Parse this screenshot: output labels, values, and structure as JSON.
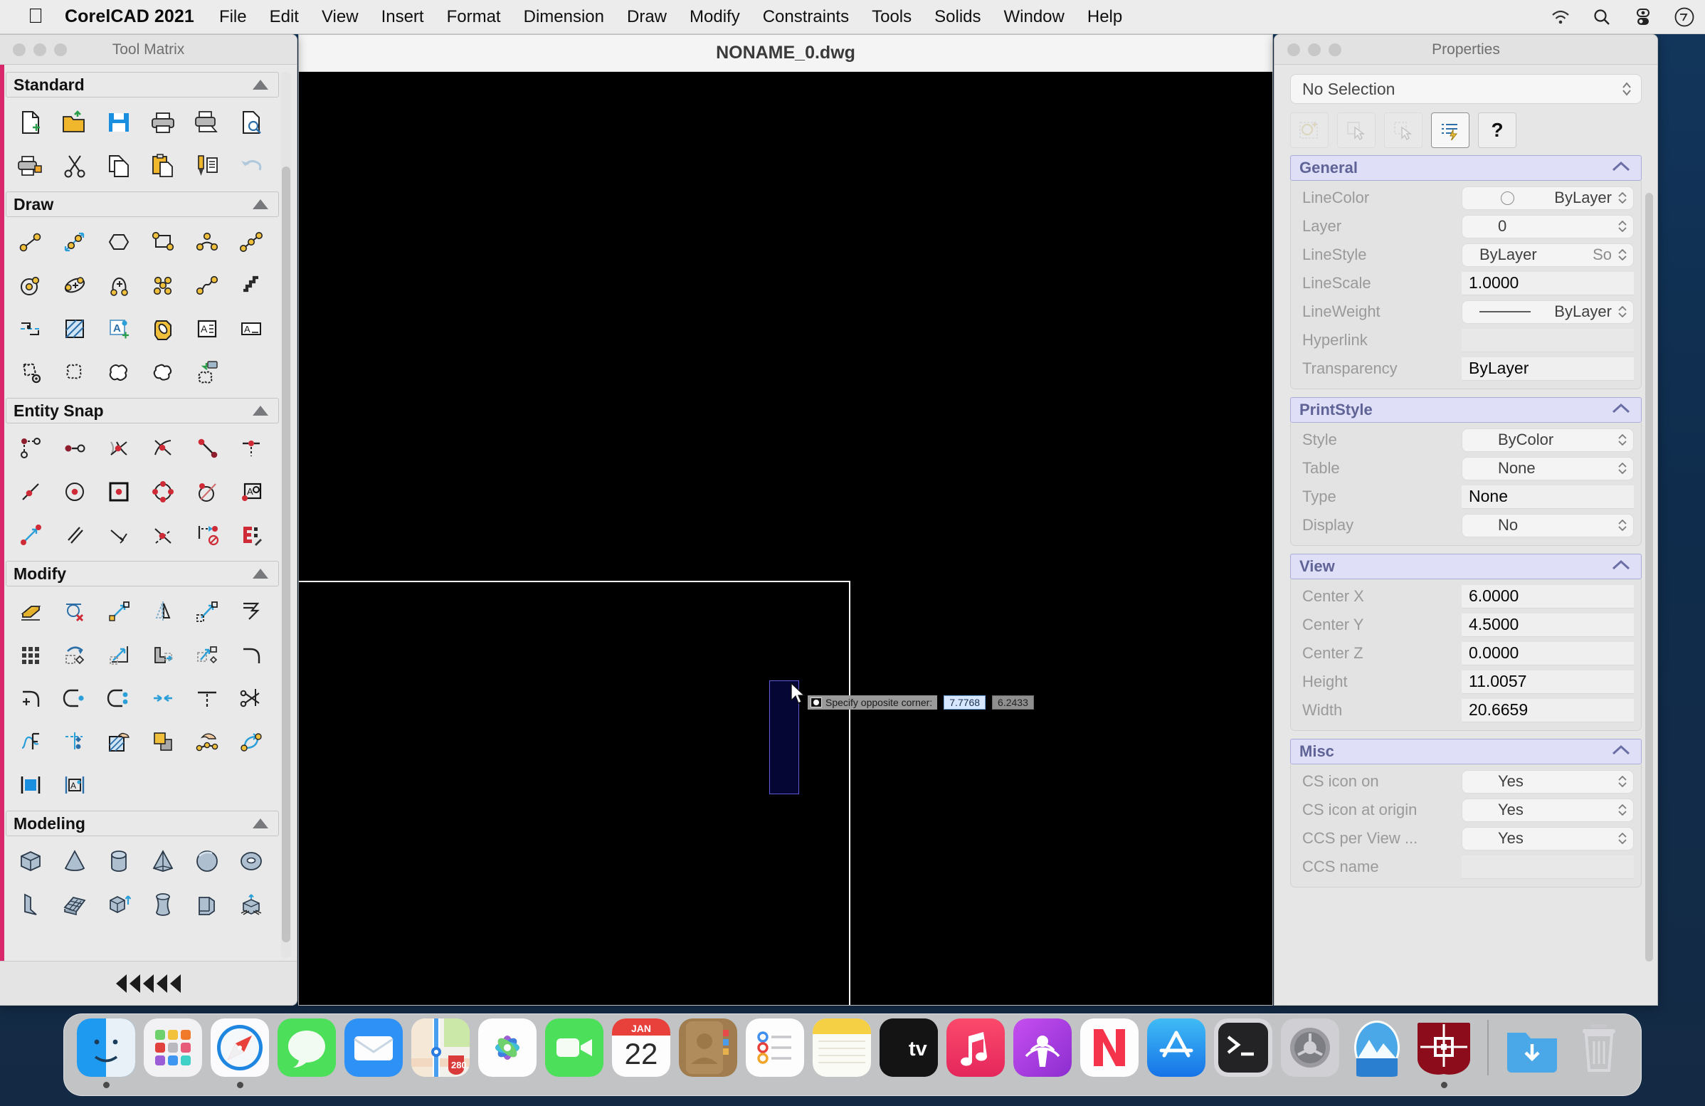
{
  "menubar": {
    "apple_icon": "apple-logo-icon",
    "app_name": "CorelCAD 2021",
    "items": [
      "File",
      "Edit",
      "View",
      "Insert",
      "Format",
      "Dimension",
      "Draw",
      "Modify",
      "Constraints",
      "Tools",
      "Solids",
      "Window",
      "Help"
    ],
    "status_icons": [
      "wifi-icon",
      "search-icon",
      "control-center-icon",
      "siri-icon"
    ]
  },
  "tool_matrix": {
    "window_title": "Tool Matrix",
    "accent_color": "#d9276b",
    "sections": [
      {
        "label": "Standard",
        "tools": [
          "new-file-icon",
          "open-folder-icon",
          "save-icon",
          "print-icon",
          "print-preview-icon",
          "page-preview-icon",
          "print-setup-icon",
          "cut-icon",
          "copy-icon",
          "paste-icon",
          "format-painter-icon",
          "undo-icon"
        ]
      },
      {
        "label": "Draw",
        "tools": [
          "line-icon",
          "infinite-line-icon",
          "polygon-icon",
          "rectangle-icon",
          "arc-icon",
          "polyline-icon",
          "circle-icon",
          "ellipse-icon",
          "ellipse-arc-icon",
          "point-icon",
          "spline-icon",
          "freehand-icon",
          "block-icon",
          "hatch-icon",
          "text-add-icon",
          "region-icon",
          "multiline-text-icon",
          "simple-note-icon",
          "boundary-settings-icon",
          "boundary-icon",
          "cloud-icon",
          "revision-cloud-icon",
          "import-boundary-icon"
        ]
      },
      {
        "label": "Entity Snap",
        "tools": [
          "snap-from-icon",
          "snap-endpoint-icon",
          "snap-midpoint-icon",
          "snap-intersection-icon",
          "snap-apparent-icon",
          "snap-perpendicular-icon",
          "snap-nearest-icon",
          "snap-center-icon",
          "snap-node-icon",
          "snap-quadrant-icon",
          "snap-tangent-icon",
          "snap-insertion-icon",
          "snap-parallel-extension-icon",
          "snap-parallel-icon",
          "snap-extension-icon",
          "snap-ray-icon",
          "snap-none-icon",
          "snap-settings-icon"
        ]
      },
      {
        "label": "Modify",
        "tools": [
          "erase-icon",
          "delete-duplicates-icon",
          "move-icon",
          "mirror-icon",
          "copy-entity-icon",
          "chamfer-edge-icon",
          "pattern-icon",
          "rotate-icon",
          "scale-icon",
          "stretch-icon",
          "move-rotate-icon",
          "fillet-icon",
          "fillet-add-icon",
          "lengthen-icon",
          "break-icon",
          "join-icon",
          "trim-icon",
          "split-icon",
          "edit-spline-icon",
          "edit-reference-icon",
          "edit-hatch-icon",
          "overlap-icon",
          "edit-polyline-icon",
          "reverse-icon",
          "edit-attribute-block-icon",
          "edit-attribute-text-icon"
        ]
      },
      {
        "label": "Modeling",
        "tools": [
          "box-icon",
          "cone-icon",
          "cylinder-icon",
          "pyramid-icon",
          "sphere-icon",
          "torus-icon",
          "wedge-icon",
          "mesh-icon",
          "extrude-icon",
          "revolve-icon",
          "loft-icon",
          "sweep-icon"
        ]
      }
    ],
    "footer_icon": "collapse-arrows-icon"
  },
  "document": {
    "title": "NONAME_0.dwg",
    "canvas_bg": "#000000",
    "tooltip": {
      "prompt": "Specify opposite corner:",
      "x_value": "7.7768",
      "y_value": "6.2433",
      "icon": "prompt-cursor-icon"
    },
    "selection_rect_color": "#5b5bd6"
  },
  "properties": {
    "window_title": "Properties",
    "selection": "No Selection",
    "toolbar": [
      {
        "name": "quick-select-icon",
        "enabled": false
      },
      {
        "name": "select-entity-icon",
        "enabled": false
      },
      {
        "name": "select-window-icon",
        "enabled": false
      },
      {
        "name": "quick-properties-icon",
        "enabled": true
      },
      {
        "name": "help-icon",
        "label": "?",
        "enabled": true
      }
    ],
    "groups": [
      {
        "title": "General",
        "rows": [
          {
            "key": "LineColor",
            "value": "ByLayer",
            "type": "color-combo"
          },
          {
            "key": "Layer",
            "value": "0",
            "type": "combo"
          },
          {
            "key": "LineStyle",
            "value": "ByLayer",
            "suffix": "So",
            "type": "combo"
          },
          {
            "key": "LineScale",
            "value": "1.0000",
            "type": "text"
          },
          {
            "key": "LineWeight",
            "value": "ByLayer",
            "type": "weight-combo"
          },
          {
            "key": "Hyperlink",
            "value": "",
            "type": "blank"
          },
          {
            "key": "Transparency",
            "value": "ByLayer",
            "type": "text"
          }
        ]
      },
      {
        "title": "PrintStyle",
        "rows": [
          {
            "key": "Style",
            "value": "ByColor",
            "type": "combo"
          },
          {
            "key": "Table",
            "value": "None",
            "type": "combo"
          },
          {
            "key": "Type",
            "value": "None",
            "type": "text"
          },
          {
            "key": "Display",
            "value": "No",
            "type": "combo"
          }
        ]
      },
      {
        "title": "View",
        "rows": [
          {
            "key": "Center X",
            "value": "6.0000",
            "type": "text"
          },
          {
            "key": "Center Y",
            "value": "4.5000",
            "type": "text"
          },
          {
            "key": "Center Z",
            "value": "0.0000",
            "type": "text"
          },
          {
            "key": "Height",
            "value": "11.0057",
            "type": "text"
          },
          {
            "key": "Width",
            "value": "20.6659",
            "type": "text"
          }
        ]
      },
      {
        "title": "Misc",
        "rows": [
          {
            "key": "CS icon on",
            "value": "Yes",
            "type": "combo"
          },
          {
            "key": "CS icon at origin",
            "value": "Yes",
            "type": "combo"
          },
          {
            "key": "CCS per View ...",
            "value": "Yes",
            "type": "combo"
          },
          {
            "key": "CCS name",
            "value": "",
            "type": "blank"
          }
        ]
      }
    ]
  },
  "dock": {
    "apps": [
      {
        "name": "finder-icon",
        "running": true
      },
      {
        "name": "launchpad-icon",
        "running": false
      },
      {
        "name": "safari-icon",
        "running": true
      },
      {
        "name": "messages-icon",
        "running": false
      },
      {
        "name": "mail-icon",
        "running": false
      },
      {
        "name": "maps-icon",
        "running": false
      },
      {
        "name": "photos-icon",
        "running": false
      },
      {
        "name": "facetime-icon",
        "running": false
      },
      {
        "name": "calendar-icon",
        "running": false,
        "month": "JAN",
        "day": "22"
      },
      {
        "name": "contacts-icon",
        "running": false
      },
      {
        "name": "reminders-icon",
        "running": false
      },
      {
        "name": "notes-icon",
        "running": false
      },
      {
        "name": "appletv-icon",
        "running": false,
        "label": "tv"
      },
      {
        "name": "music-icon",
        "running": false
      },
      {
        "name": "podcasts-icon",
        "running": false
      },
      {
        "name": "news-icon",
        "running": false
      },
      {
        "name": "appstore-icon",
        "running": false
      },
      {
        "name": "terminal-icon",
        "running": false
      },
      {
        "name": "system-preferences-icon",
        "running": false
      },
      {
        "name": "preview-icon",
        "running": false
      },
      {
        "name": "corelcad-icon",
        "running": true
      }
    ],
    "trailing": [
      {
        "name": "downloads-folder-icon"
      },
      {
        "name": "trash-icon"
      }
    ]
  }
}
